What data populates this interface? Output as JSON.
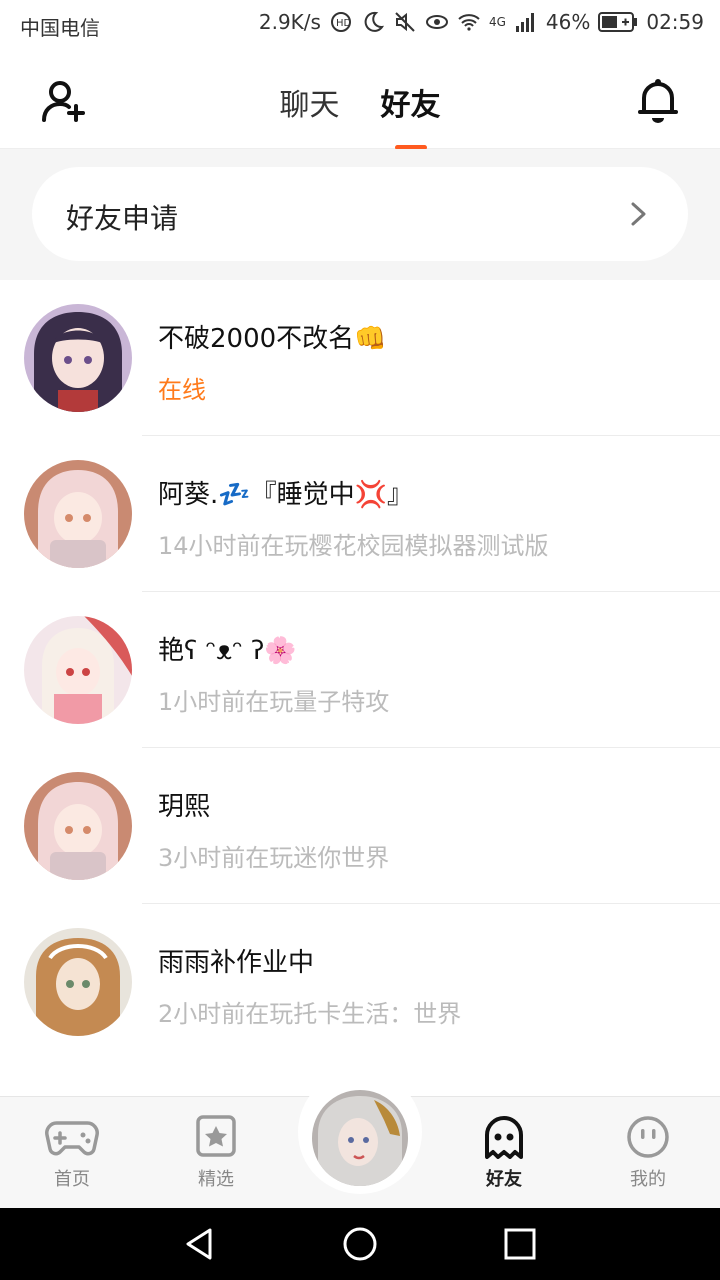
{
  "status_bar": {
    "carrier": "中国电信",
    "speed": "2.9K/s",
    "network": "4G",
    "battery": "46%",
    "time": "02:59"
  },
  "header": {
    "tabs": [
      {
        "label": "聊天",
        "active": false
      },
      {
        "label": "好友",
        "active": true
      }
    ],
    "accent_color": "#ff5a1f"
  },
  "friend_request": {
    "label": "好友申请"
  },
  "friends": [
    {
      "name": "不破2000不改名👊",
      "status": "在线",
      "online": true
    },
    {
      "name": "阿葵.💤『睡觉中💢』",
      "status": "14小时前在玩樱花校园模拟器测试版",
      "online": false
    },
    {
      "name": "艳ʕ ᵔᴥᵔ ʔ🌸",
      "status": "1小时前在玩量子特攻",
      "online": false
    },
    {
      "name": "玥熙",
      "status": "3小时前在玩迷你世界",
      "online": false
    },
    {
      "name": "雨雨补作业中",
      "status": "2小时前在玩托卡生活：世界",
      "online": false
    }
  ],
  "bottom_nav": {
    "items": [
      {
        "label": "首页",
        "icon": "gamepad-icon"
      },
      {
        "label": "精选",
        "icon": "star-badge-icon"
      },
      {
        "label": "好友",
        "icon": "ghost-icon",
        "active": true
      },
      {
        "label": "我的",
        "icon": "smile-face-icon"
      }
    ]
  }
}
